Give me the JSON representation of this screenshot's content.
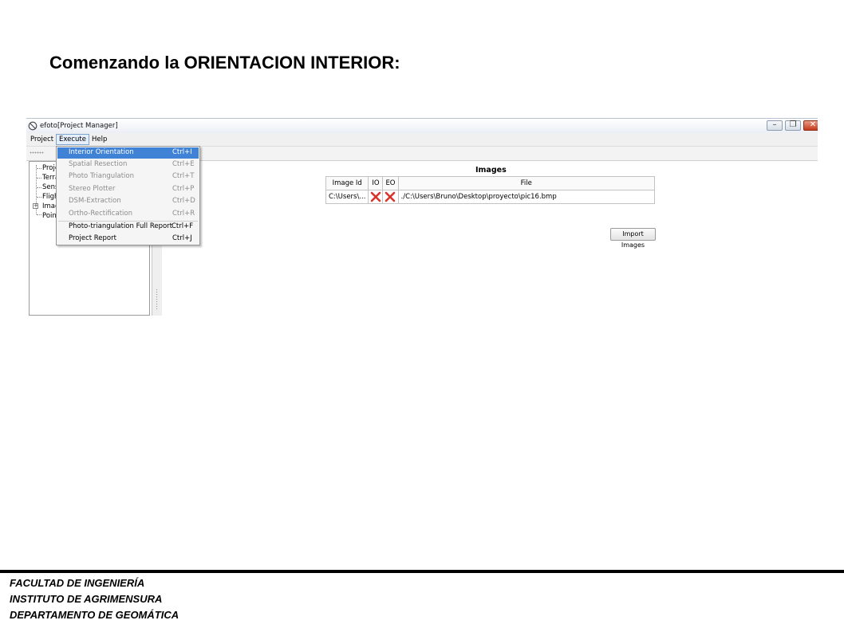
{
  "slide": {
    "title": "Comenzando la ORIENTACION INTERIOR:",
    "footer": [
      "FACULTAD DE INGENIERÍA",
      "INSTITUTO DE AGRIMENSURA",
      "DEPARTAMENTO DE GEOMÁTICA"
    ]
  },
  "window": {
    "title": "efoto[Project Manager]",
    "icon": "efoto-app-icon",
    "controls": [
      "minimize",
      "maximize",
      "close"
    ]
  },
  "menubar": {
    "items": [
      "Project",
      "Execute",
      "Help"
    ],
    "open_menu": "Execute"
  },
  "execute_menu": {
    "items": [
      {
        "label": "Interior Orientation",
        "shortcut": "Ctrl+I",
        "state": "highlighted"
      },
      {
        "label": "Spatial Resection",
        "shortcut": "Ctrl+E",
        "state": "disabled"
      },
      {
        "label": "Photo Triangulation",
        "shortcut": "Ctrl+T",
        "state": "disabled"
      },
      {
        "label": "Stereo Plotter",
        "shortcut": "Ctrl+P",
        "state": "disabled"
      },
      {
        "label": "DSM-Extraction",
        "shortcut": "Ctrl+D",
        "state": "disabled"
      },
      {
        "label": "Ortho-Rectification",
        "shortcut": "Ctrl+R",
        "state": "disabled"
      },
      {
        "label": "Photo-triangulation Full Report",
        "shortcut": "Ctrl+F",
        "state": "enabled"
      },
      {
        "label": "Project Report",
        "shortcut": "Ctrl+J",
        "state": "enabled"
      }
    ]
  },
  "tree": {
    "items": [
      "Proje",
      "Terra",
      "Sens",
      "Fligh",
      "Imag",
      "Point"
    ]
  },
  "images_panel": {
    "heading": "Images",
    "columns": [
      "Image Id",
      "IO",
      "EO",
      "File"
    ],
    "rows": [
      {
        "image_id": "C:\\Users\\...",
        "io": "not-done-x-icon",
        "eo": "not-done-x-icon",
        "file": "./C:\\Users\\Bruno\\Desktop\\proyecto\\pic16.bmp"
      }
    ],
    "import_button": "Import Images"
  },
  "colors": {
    "menu_highlight": "#3f82d6",
    "x_icon": "#d9332b",
    "footer_rule": "#000000"
  }
}
